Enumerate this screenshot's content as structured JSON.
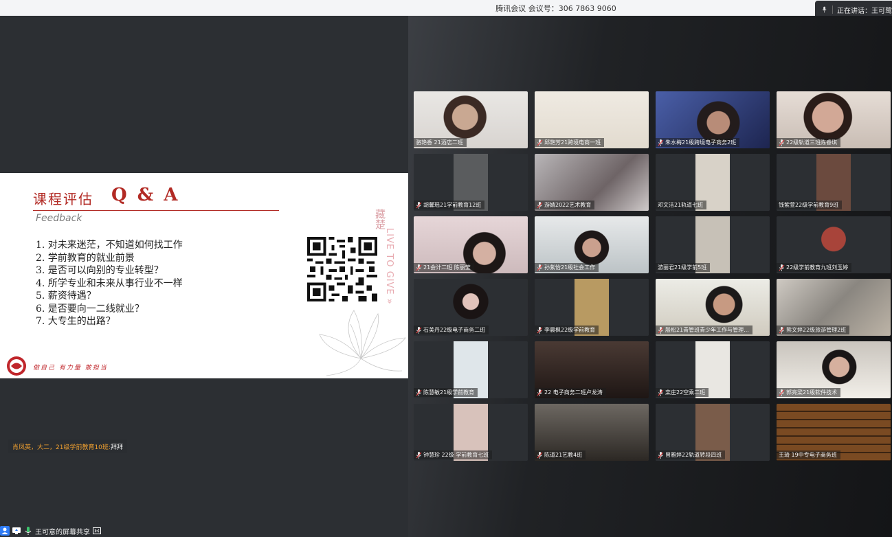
{
  "topbar": {
    "meeting_title": "腾讯会议 会议号：306 7863 9060",
    "speaking_label": "正在讲话：王可鹭"
  },
  "slide": {
    "title": "课程评估",
    "qa": "Q & A",
    "subtitle": "Feedback",
    "items": [
      "1. 对未来迷茫，不知道如何找工作",
      "2. 学前教育的就业前景",
      "3. 是否可以向别的专业转型？",
      "4. 所学专业和未来从事行业不一样",
      "5. 薪资待遇？",
      "6. 是否要向一二线就业？",
      "7. 大专生的出路？"
    ],
    "vertical_text": "LIVE TO GIVE »",
    "side_text": "藏楚",
    "motto": "做自己 有力量 敢担当"
  },
  "chat": {
    "sender": "肖凤英，大二，21级学前教育10班:",
    "content": " 拜拜"
  },
  "share_bar": {
    "label": "王可意的屏幕共享"
  },
  "participants": [
    {
      "name": "骆艳香 21酒店二班",
      "mic": false,
      "scene": "face-light"
    },
    {
      "name": "邱艳芳21跨境电商一班",
      "mic": true,
      "scene": "room-paintings"
    },
    {
      "name": "朱水梅21级跨境电子商务2班",
      "mic": true,
      "scene": "face-blue"
    },
    {
      "name": "22级轨道三班陈睿琪",
      "mic": true,
      "scene": "face-glasses"
    },
    {
      "name": "胡馨瑶21学前教育12班",
      "mic": true,
      "scene": "narrow-dark"
    },
    {
      "name": "游婧2022艺术教育",
      "mic": true,
      "scene": "blurred-room"
    },
    {
      "name": "邓文洁21轨道七班",
      "mic": false,
      "scene": "narrow-bright"
    },
    {
      "name": "钱紫萱22级学前教育9班",
      "mic": false,
      "scene": "narrow-person"
    },
    {
      "name": "21会计二班 陈丽莹",
      "mic": true,
      "scene": "face-pink"
    },
    {
      "name": "孙紫怡21级社会工作",
      "mic": true,
      "scene": "room-face"
    },
    {
      "name": "游丽君21级学前5班",
      "mic": false,
      "scene": "narrow-shelf"
    },
    {
      "name": "22级学前教育九班刘玉婷",
      "mic": true,
      "scene": "avatar-red"
    },
    {
      "name": "石美丹22级电子商务二班",
      "mic": true,
      "scene": "avatar-girl"
    },
    {
      "name": "李晨枫22级学前教育",
      "mic": true,
      "scene": "narrow-ceiling"
    },
    {
      "name": "殷松21青管班青少年工作与管理...",
      "mic": true,
      "scene": "face-boy"
    },
    {
      "name": "熊文婷22级旅游管理2班",
      "mic": true,
      "scene": "room-clutter"
    },
    {
      "name": "陈慧敏21级学前教育",
      "mic": true,
      "scene": "narrow-white"
    },
    {
      "name": "22 电子商务二班卢龙涛",
      "mic": true,
      "scene": "dark-brown"
    },
    {
      "name": "栾庄22空乘二班",
      "mic": true,
      "scene": "narrow-face"
    },
    {
      "name": "郭亮梁21级软件技术",
      "mic": true,
      "scene": "face-boy2"
    },
    {
      "name": "钟慧珍 22级 学前教育七班",
      "mic": true,
      "scene": "narrow-girl"
    },
    {
      "name": "陈道21艺教4班",
      "mic": true,
      "scene": "dark-figure"
    },
    {
      "name": "曾雅婷22轨道转段四班",
      "mic": true,
      "scene": "narrow-blur"
    },
    {
      "name": "王琦 19中专电子商务班",
      "mic": false,
      "scene": "library"
    }
  ],
  "colors": {
    "slide_accent": "#b22a24",
    "chat_sender": "#f0a030",
    "background": "#2a2d31"
  }
}
